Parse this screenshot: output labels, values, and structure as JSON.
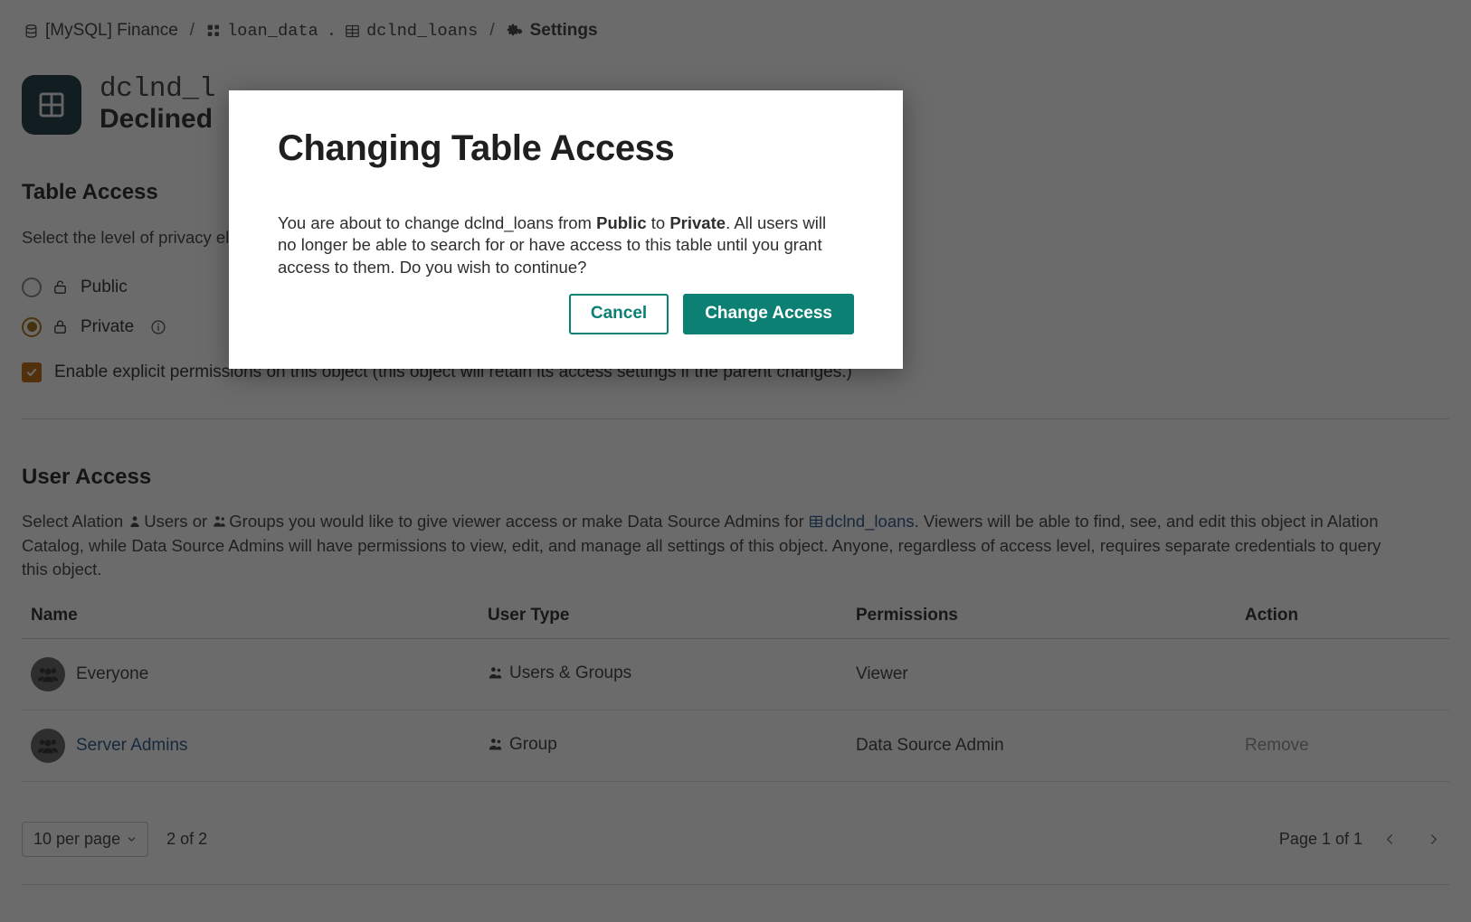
{
  "breadcrumb": {
    "datasource_icon": "database-icon",
    "datasource": "[MySQL] Finance",
    "sep1": "/",
    "schema_icon": "schema-icon",
    "schema": "loan_data",
    "dot": ".",
    "table_icon": "table-icon",
    "table": "dclnd_loans",
    "sep2": "/",
    "settings_icon": "gear-icon",
    "settings": "Settings"
  },
  "header": {
    "object_icon": "table-grid-icon",
    "title": "dclnd_l",
    "subtitle": "Declined"
  },
  "table_access": {
    "heading": "Table Access",
    "description": "Select the level of privacy                                                      electing Private will let certain users access this object.",
    "options": [
      {
        "label": "Public",
        "icon": "unlock-icon",
        "selected": false
      },
      {
        "label": "Private",
        "icon": "lock-icon",
        "selected": true,
        "info_icon": "info-icon"
      }
    ],
    "explicit_permissions": {
      "label": "Enable explicit permissions on this object (this object will retain its access settings if the parent changes.)",
      "checked": true,
      "check_icon": "check-icon"
    }
  },
  "user_access": {
    "heading": "User Access",
    "description_1": "Select Alation ",
    "users_icon": "user-icon",
    "users_word": "Users",
    "description_2": " or ",
    "groups_icon": "group-icon",
    "groups_word": "Groups",
    "description_3": " you would like to give viewer access or make Data Source Admins for ",
    "link_icon": "table-icon",
    "link_text": "dclnd_loans",
    "description_4": ". Viewers will be able to find, see, and edit this object in Alation Catalog, while Data Source Admins will have permissions to view, edit, and manage all settings of this object. Anyone, regardless of access level, requires separate credentials to query this object.",
    "columns": [
      "Name",
      "User Type",
      "Permissions",
      "Action"
    ],
    "rows": [
      {
        "avatar_icon": "group-avatar-icon",
        "name": "Everyone",
        "name_is_link": false,
        "type_icon": "group-icon",
        "user_type": "Users & Groups",
        "permissions": "Viewer",
        "action": ""
      },
      {
        "avatar_icon": "group-avatar-icon",
        "name": "Server Admins",
        "name_is_link": true,
        "type_icon": "group-icon",
        "user_type": "Group",
        "permissions": "Data Source Admin",
        "action": "Remove"
      }
    ],
    "pagination": {
      "per_page": "10 per page",
      "per_page_caret": "chevron-down-icon",
      "count": "2 of 2",
      "page_label": "Page 1 of 1",
      "prev_icon": "chevron-left-icon",
      "next_icon": "chevron-right-icon"
    }
  },
  "modal": {
    "title": "Changing Table Access",
    "body_1": "You are about to change dclnd_loans from ",
    "body_bold_1": "Public",
    "body_2": " to ",
    "body_bold_2": "Private",
    "body_3": ". All users will no longer be able to search for or have access to this table until you grant access to them. Do you wish to continue?",
    "cancel_label": "Cancel",
    "confirm_label": "Change Access"
  },
  "colors": {
    "teal": "#0d8074",
    "object_icon_bg": "#2b4650",
    "radio_selected": "#a3781f",
    "checkbox": "#c2721c",
    "link": "#37628f"
  }
}
